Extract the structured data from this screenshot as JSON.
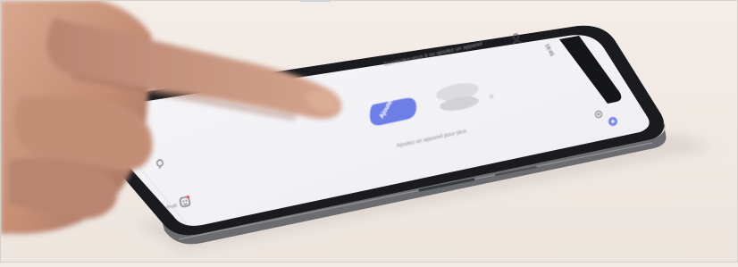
{
  "app": {
    "empty_state_text_1": "Connectez-vous à ou ajoutez un appareil",
    "empty_state_text_2": "Ajoutez un appareil pour plus",
    "add_button_label": "Ajouter",
    "tab_profile_label": "Profil"
  },
  "colors": {
    "accent": "#6d7ee6",
    "backdrop": "#f2ebe5",
    "screen": "#f3f3f6",
    "phone_body": "#1a1b1f",
    "skin": "#c9987f"
  },
  "icons": {
    "add_icon": "plus-circle",
    "user_icon": "person",
    "device_icon": "smart-speaker",
    "home_tab_icon": "lightbulb",
    "profile_tab_icon": "smiley-face"
  }
}
